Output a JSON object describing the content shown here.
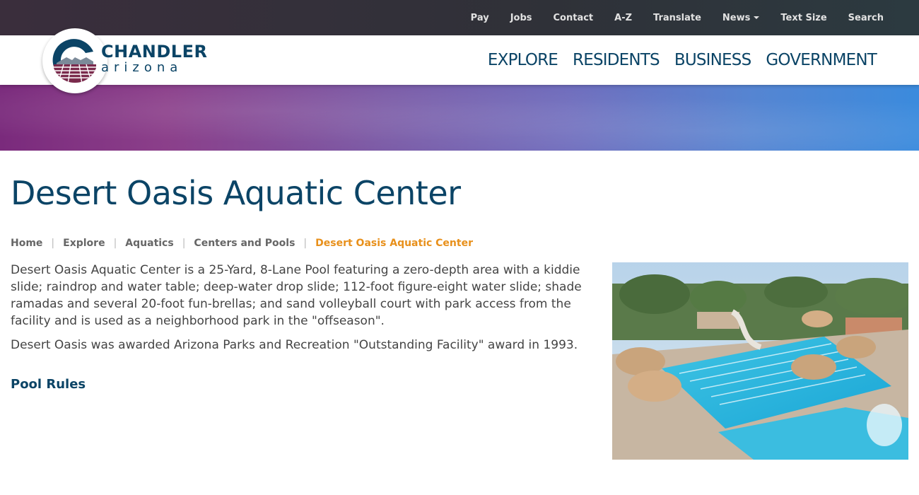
{
  "utility_nav": {
    "items": [
      {
        "label": "Pay"
      },
      {
        "label": "Jobs"
      },
      {
        "label": "Contact"
      },
      {
        "label": "A-Z"
      },
      {
        "label": "Translate"
      },
      {
        "label": "News",
        "has_dropdown": true
      },
      {
        "label": "Text Size"
      },
      {
        "label": "Search"
      }
    ]
  },
  "logo": {
    "line1": "CHANDLER",
    "line2": "arizona"
  },
  "main_nav": {
    "items": [
      {
        "label": "EXPLORE"
      },
      {
        "label": "RESIDENTS"
      },
      {
        "label": "BUSINESS"
      },
      {
        "label": "GOVERNMENT"
      }
    ]
  },
  "page": {
    "title": "Desert Oasis Aquatic Center",
    "breadcrumb": [
      {
        "label": "Home"
      },
      {
        "label": "Explore"
      },
      {
        "label": "Aquatics"
      },
      {
        "label": "Centers and Pools"
      },
      {
        "label": "Desert Oasis Aquatic Center",
        "current": true
      }
    ],
    "paragraphs": [
      "Desert Oasis Aquatic Center is a 25-Yard, 8-Lane Pool featuring a zero-depth area with a kiddie slide; raindrop and water table; deep-water drop slide; 112-foot figure-eight water slide; shade ramadas and several 20-foot fun-brellas; and sand volleyball court with park access from the facility and is used as a neighborhood park in the \"offseason\".",
      "Desert Oasis was awarded Arizona Parks and Recreation \"Outstanding Facility\" award in 1993."
    ],
    "pool_rules_link": "Pool Rules"
  },
  "colors": {
    "navy": "#0b4466",
    "accent_orange": "#e8901b",
    "utility_bar": "#2f3138",
    "body_text": "#444444",
    "banner_purple": "#7a2a7c",
    "banner_blue": "#3b8bdd"
  },
  "icons": {
    "logo": "chandler-city-seal-icon",
    "dropdown": "caret-down-icon"
  }
}
